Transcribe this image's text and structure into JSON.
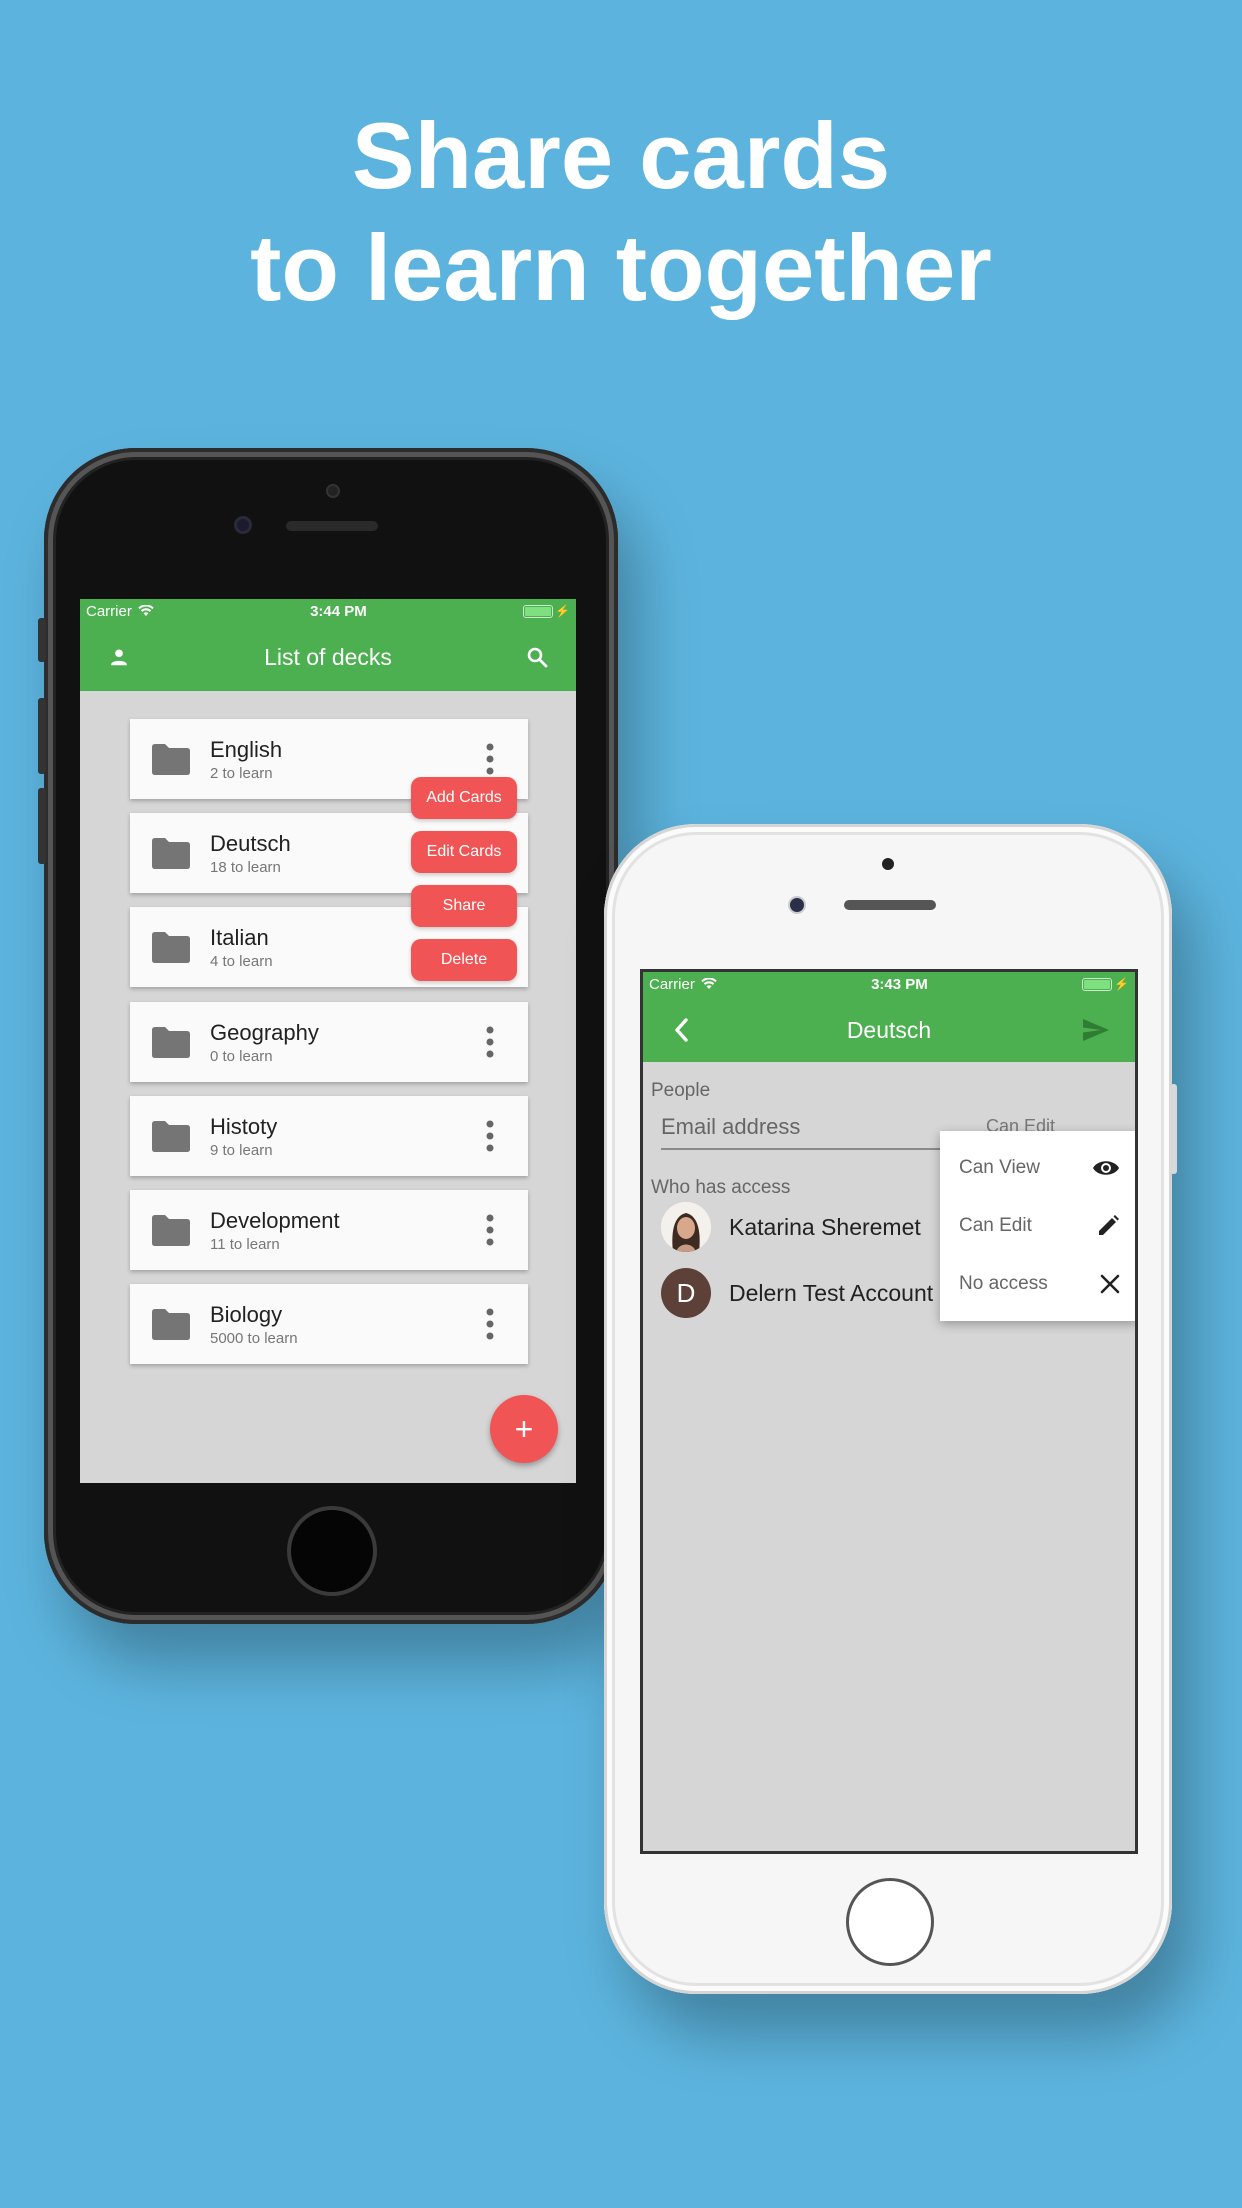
{
  "headline": {
    "line1": "Share cards",
    "line2": "to learn together"
  },
  "left_phone": {
    "status": {
      "carrier": "Carrier",
      "time": "3:44 PM"
    },
    "appbar": {
      "title": "List of decks",
      "left_icon": "person-icon",
      "right_icon": "search-icon"
    },
    "decks": [
      {
        "name": "English",
        "sub": "2 to learn"
      },
      {
        "name": "Deutsch",
        "sub": "18 to learn"
      },
      {
        "name": "Italian",
        "sub": "4 to learn"
      },
      {
        "name": "Geography",
        "sub": "0 to learn"
      },
      {
        "name": "Histoty",
        "sub": "9 to learn"
      },
      {
        "name": "Development",
        "sub": "11 to learn"
      },
      {
        "name": "Biology",
        "sub": "5000 to learn"
      }
    ],
    "context_menu": [
      "Add Cards",
      "Edit Cards",
      "Share",
      "Delete"
    ],
    "fab_label": "+"
  },
  "right_phone": {
    "status": {
      "carrier": "Carrier",
      "time": "3:43 PM"
    },
    "appbar": {
      "title": "Deutsch",
      "left_icon": "chevron-left-icon",
      "right_icon": "send-icon"
    },
    "people_label": "People",
    "email_placeholder": "Email address",
    "permission_value": "Can Edit",
    "who_has_access_label": "Who has access",
    "people": [
      {
        "name": "Katarina Sheremet",
        "avatar": "photo"
      },
      {
        "name": "Delern Test Account",
        "avatar_letter": "D"
      }
    ],
    "permission_options": [
      {
        "label": "Can View",
        "icon": "eye-icon"
      },
      {
        "label": "Can Edit",
        "icon": "pencil-icon"
      },
      {
        "label": "No access",
        "icon": "close-icon"
      }
    ]
  },
  "colors": {
    "background": "#5cb4de",
    "appbar": "#4caf50",
    "accent": "#f05454"
  }
}
